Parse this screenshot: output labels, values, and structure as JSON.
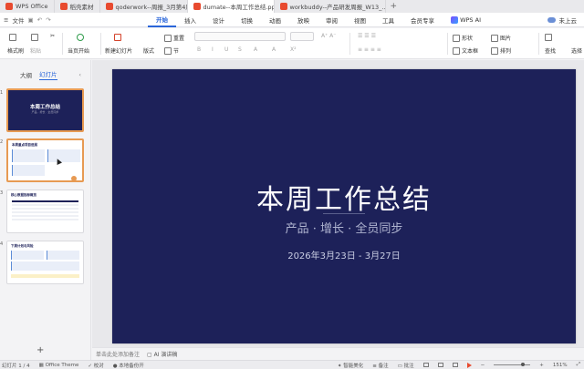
{
  "tabs": [
    {
      "label": "WPS Office",
      "active": false
    },
    {
      "label": "稻壳素材",
      "active": false
    },
    {
      "label": "qoderwork--周报_3月第4周.pptx",
      "active": false
    },
    {
      "label": "dumate--本周工作总结.pptx",
      "active": true
    },
    {
      "label": "workbuddy--产品研发周报_W13_...",
      "active": false
    }
  ],
  "menubar": {
    "file": "文件",
    "items": [
      "开始",
      "插入",
      "设计",
      "切换",
      "动画",
      "放映",
      "审阅",
      "视图",
      "工具",
      "会员专享"
    ],
    "active": "开始",
    "wps_ai": "WPS AI",
    "cloud": "未上云"
  },
  "ribbon": {
    "format_painter": "格式刷",
    "paste": "粘贴",
    "play_from_current": "当页开始",
    "new_slide": "新建幻灯片",
    "layout": "版式",
    "section": "节",
    "reset": "重置",
    "shape": "形状",
    "image": "图片",
    "textbox": "文本框",
    "arrange": "排列",
    "find": "查找",
    "select": "选择"
  },
  "left_pane": {
    "tab_outline": "大纲",
    "tab_slides": "幻灯片",
    "slides": [
      {
        "num": "1",
        "title": "本周工作总结",
        "sub": "产品 · 增长 · 全员同步"
      },
      {
        "num": "2",
        "title": "本周重点项目进展"
      },
      {
        "num": "3",
        "title": "核心数据指标概览"
      },
      {
        "num": "4",
        "title": "下周计划与风险"
      }
    ]
  },
  "slide": {
    "title": "本周工作总结",
    "subtitle": "产品 · 增长 · 全员同步",
    "date": "2026年3月23日 - 3月27日"
  },
  "notes": {
    "placeholder": "单击此处添加备注",
    "ai_speech": "AI 演讲稿"
  },
  "status": {
    "slide_count": "幻灯片 1 / 4",
    "theme": "Office Theme",
    "proofing": "校对",
    "backup": "本地备份开",
    "beautify": "智能美化",
    "notes": "备注",
    "comments": "批注",
    "zoom": "151%"
  },
  "colors": {
    "slide_bg": "#1d2159",
    "accent": "#2b66d9",
    "selection": "#e79a52"
  }
}
